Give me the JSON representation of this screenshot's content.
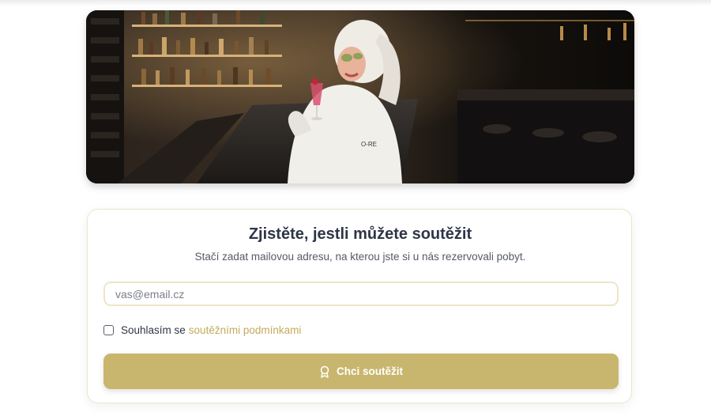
{
  "form": {
    "title": "Zjistěte, jestli můžete soutěžit",
    "subtitle": "Stačí zadat mailovou adresu, na kterou jste si u nás rezervovali pobyt.",
    "email_placeholder": "vas@email.cz",
    "email_value": "",
    "consent_text": "Souhlasím se",
    "consent_link_text": "soutěžními podmínkami",
    "consent_checked": false,
    "submit_label": "Chci soutěžit",
    "submit_icon": "award-ribbon-icon"
  },
  "hero": {
    "image_label": "woman-in-bathrobe-at-bar-photo"
  },
  "colors": {
    "accent": "#c9b66e",
    "link": "#c3aa5a",
    "title": "#2f3547",
    "border": "#ece6c8"
  }
}
